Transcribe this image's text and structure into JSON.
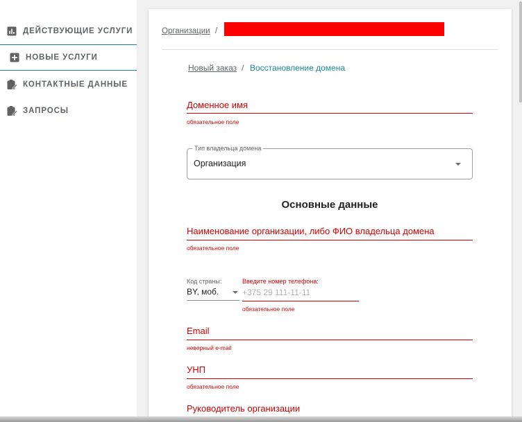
{
  "sidebar": {
    "items": [
      {
        "label": "Действующие услуги",
        "icon": "bar-chart-icon"
      },
      {
        "label": "Новые услуги",
        "icon": "add-box-icon"
      },
      {
        "label": "Контактные данные",
        "icon": "assignment-icon"
      },
      {
        "label": "Запросы",
        "icon": "assignment-icon"
      }
    ]
  },
  "header": {
    "breadcrumb_link": "Организации",
    "breadcrumb_sep": "/"
  },
  "subnav": {
    "link": "Новый заказ",
    "sep": "/",
    "current": "Восстановление домена"
  },
  "form": {
    "domain": {
      "label": "Доменное имя",
      "helper": "обязательное поле"
    },
    "owner_type": {
      "legend": "Тип владельца домена",
      "value": "Организация"
    },
    "section_title": "Основные данные",
    "org_name": {
      "label": "Наименование организации, либо ФИО владельца домена",
      "helper": "обязательное поле"
    },
    "country_code": {
      "label": "Код страны:",
      "value": "BY, моб."
    },
    "phone": {
      "label": "Введите номер телефона:",
      "placeholder": "+375 29 111-11-11",
      "helper": "обязательное поле"
    },
    "email": {
      "label": "Email",
      "helper": "неверный e-mail"
    },
    "unp": {
      "label": "УНП",
      "helper": "обязательное поле"
    },
    "director": {
      "label": "Руководитель организации"
    }
  },
  "colors": {
    "accent": "#1e8a93",
    "error": "#d50000",
    "redaction": "#ff0000"
  }
}
